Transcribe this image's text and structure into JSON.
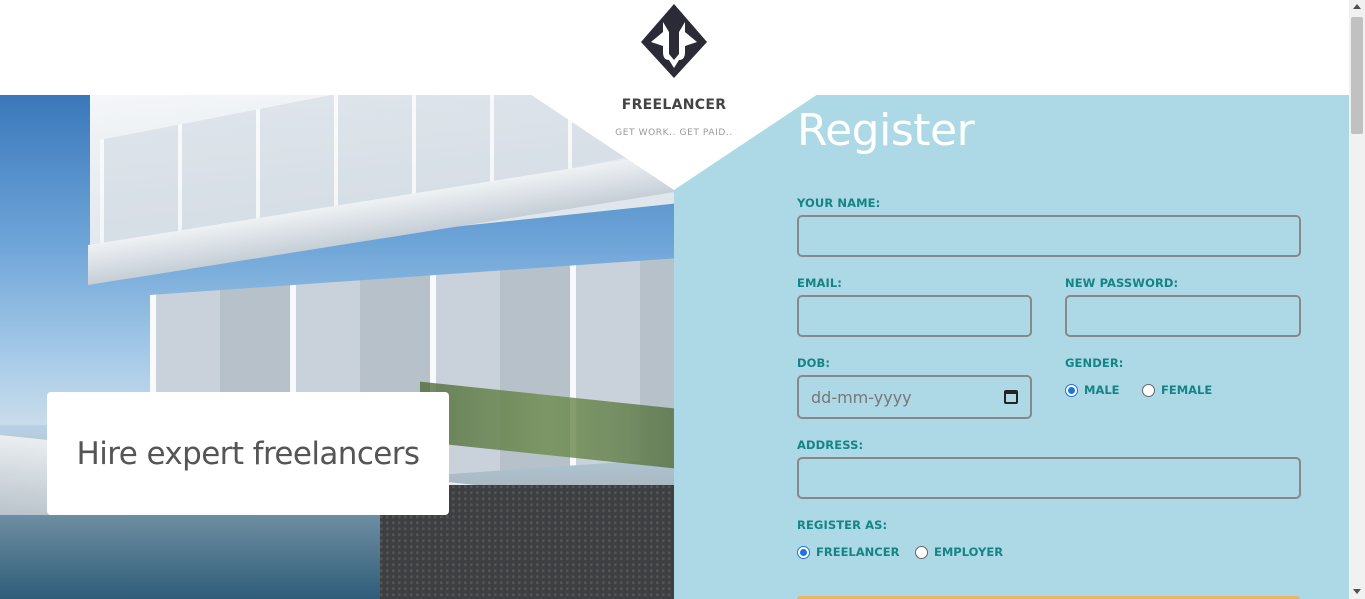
{
  "brand": {
    "name": "FREELANCER",
    "tagline": "GET WORK.. GET PAID..",
    "logo_icon": "diamond-logo-icon"
  },
  "hero": {
    "caption": "Hire expert freelancers"
  },
  "form": {
    "title": "Register",
    "name_label": "YOUR NAME:",
    "name_value": "",
    "email_label": "EMAIL:",
    "email_value": "",
    "password_label": "NEW PASSWORD:",
    "password_value": "",
    "dob_label": "DOB:",
    "dob_placeholder": "dd-mm-yyyy",
    "gender_label": "GENDER:",
    "gender_options": [
      "MALE",
      "FEMALE"
    ],
    "gender_selected": "MALE",
    "address_label": "ADDRESS:",
    "address_value": "",
    "register_as_label": "REGISTER AS:",
    "register_as_options": [
      "FREELANCER",
      "EMPLOYER"
    ],
    "register_as_selected": "FREELANCER"
  },
  "colors": {
    "panel_bg": "#add8e6",
    "label": "#138585",
    "title": "#ffffff",
    "radio_accent": "#1a73e8",
    "submit_accent": "#e8b666"
  }
}
